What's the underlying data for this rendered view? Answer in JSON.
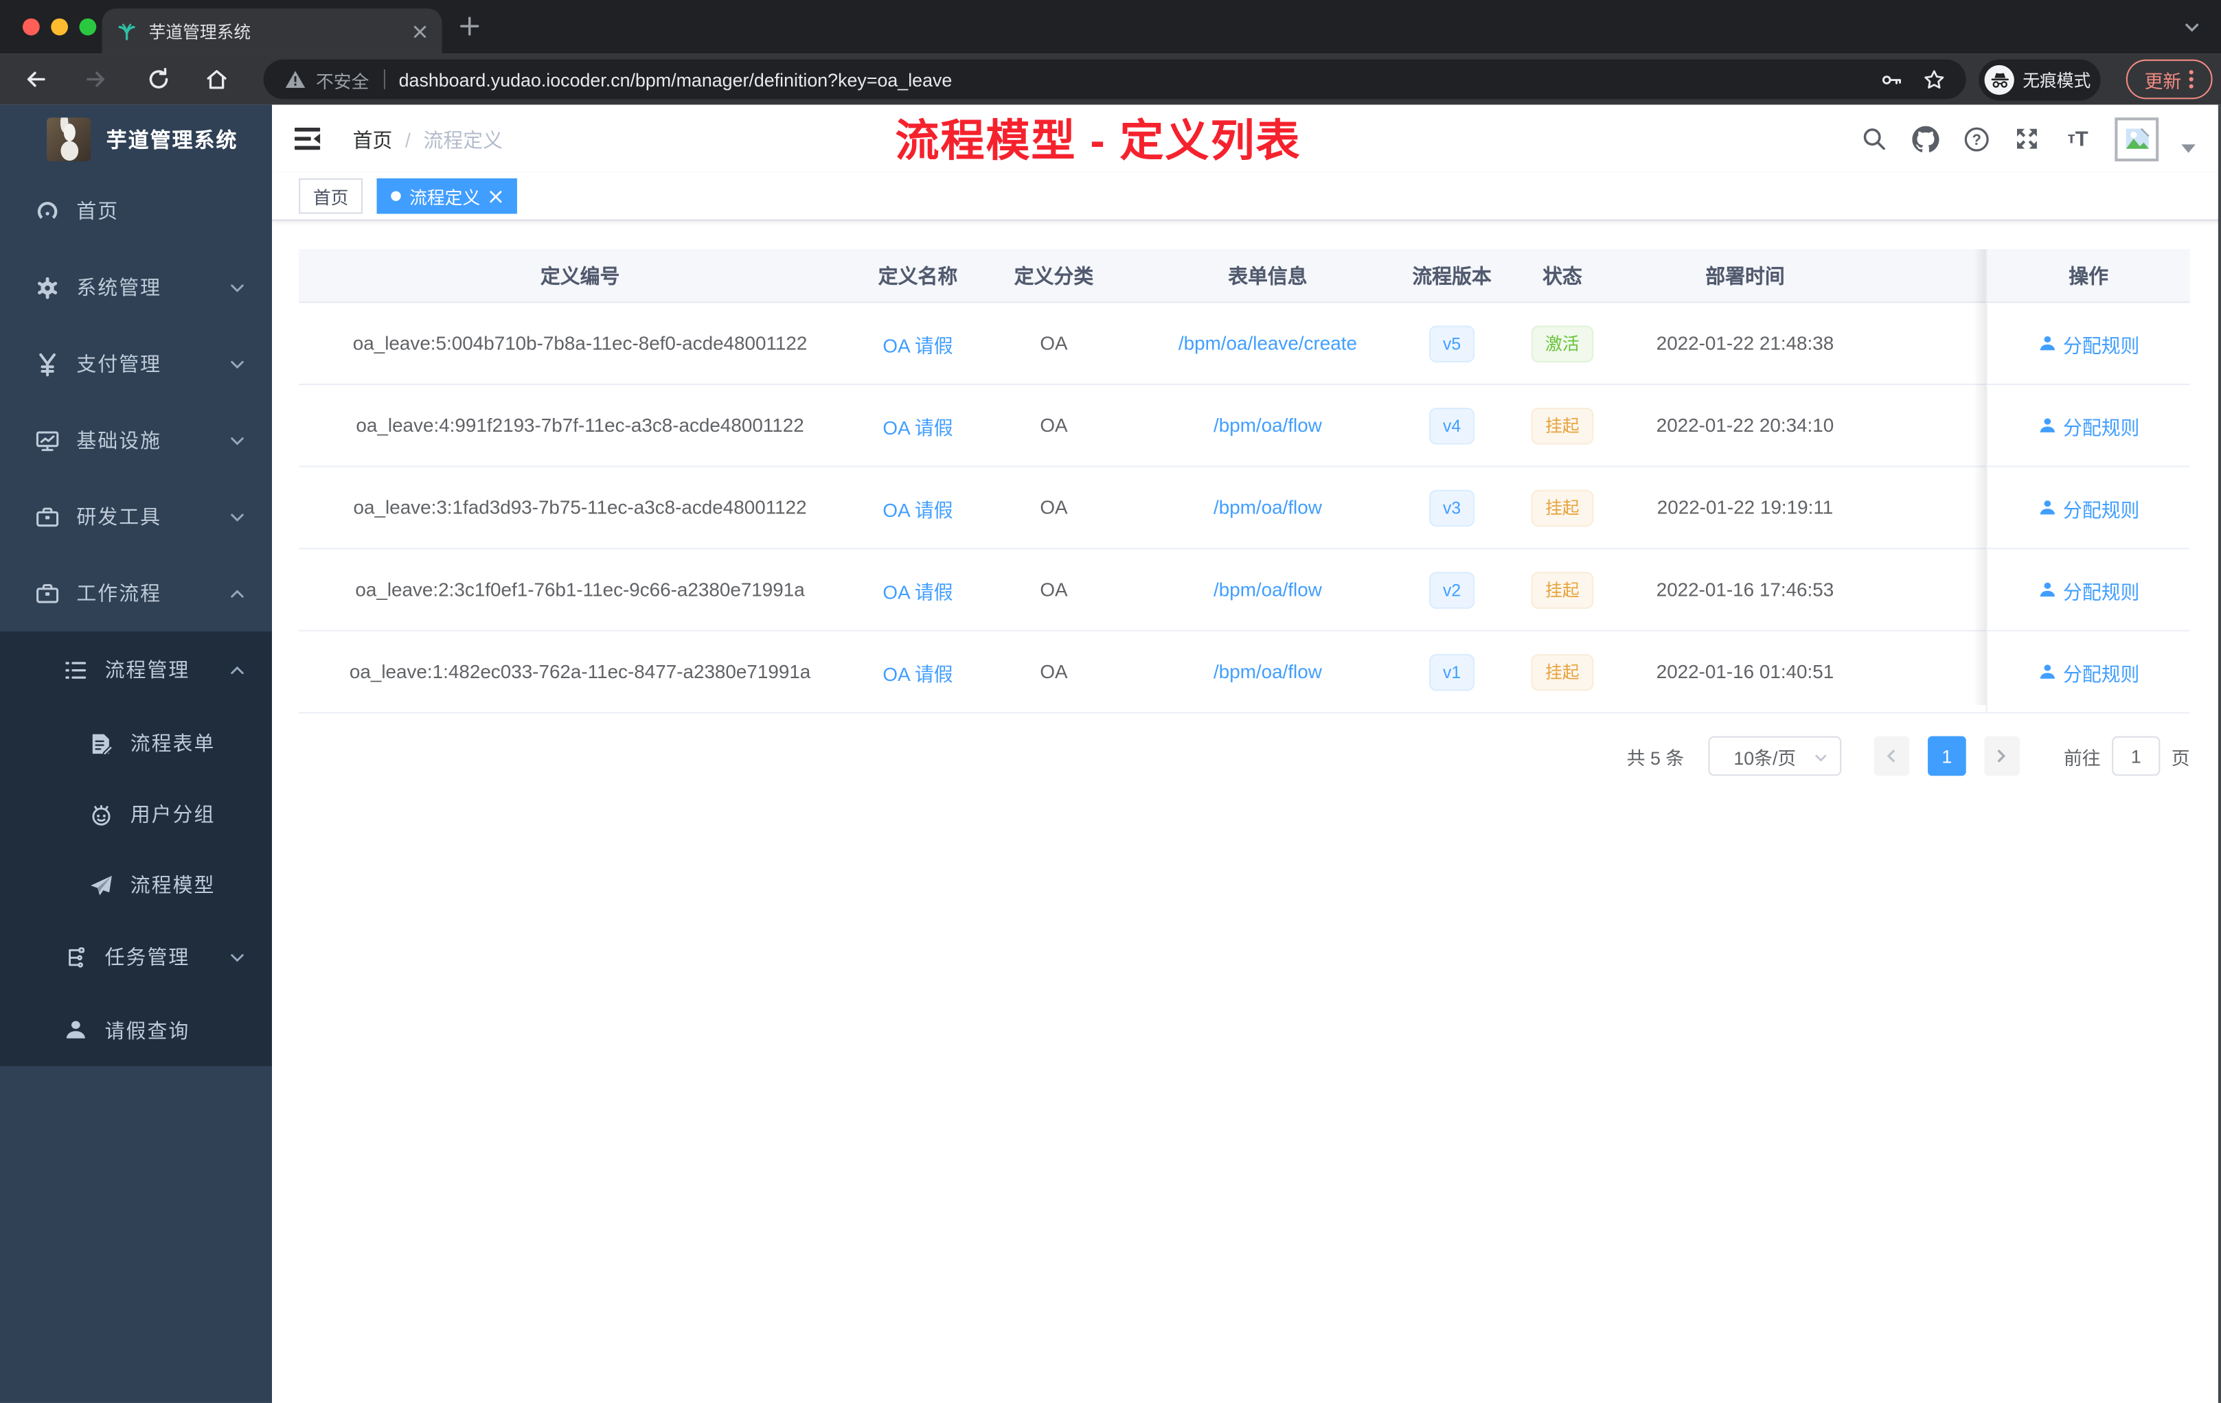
{
  "browser": {
    "tab_title": "芋道管理系统",
    "url_security": "不安全",
    "url": "dashboard.yudao.iocoder.cn/bpm/manager/definition?key=oa_leave",
    "incognito_label": "无痕模式",
    "update_label": "更新"
  },
  "sidebar": {
    "app_title": "芋道管理系统",
    "menu": [
      {
        "label": "首页",
        "icon": "dashboard-icon",
        "chevron": null,
        "level": 1
      },
      {
        "label": "系统管理",
        "icon": "gear-icon",
        "chevron": "down",
        "level": 1
      },
      {
        "label": "支付管理",
        "icon": "yen-icon",
        "chevron": "down",
        "level": 1
      },
      {
        "label": "基础设施",
        "icon": "monitor-icon",
        "chevron": "down",
        "level": 1
      },
      {
        "label": "研发工具",
        "icon": "toolbox-icon",
        "chevron": "down",
        "level": 1
      },
      {
        "label": "工作流程",
        "icon": "briefcase-icon",
        "chevron": "up",
        "level": 1
      }
    ],
    "submenu": [
      {
        "label": "流程管理",
        "icon": "list-tree-icon",
        "chevron": "up",
        "level": 2
      },
      {
        "label": "流程表单",
        "icon": "form-icon",
        "chevron": null,
        "level": 3
      },
      {
        "label": "用户分组",
        "icon": "robot-icon",
        "chevron": null,
        "level": 3
      },
      {
        "label": "流程模型",
        "icon": "paper-plane-icon",
        "chevron": null,
        "level": 3
      },
      {
        "label": "任务管理",
        "icon": "org-tree-icon",
        "chevron": "down",
        "level": 2
      },
      {
        "label": "请假查询",
        "icon": "user-icon",
        "chevron": null,
        "level": 2
      }
    ]
  },
  "navbar": {
    "breadcrumb": [
      "首页",
      "流程定义"
    ],
    "breadcrumb_separator": "/",
    "annotation": "流程模型 - 定义列表"
  },
  "tags": [
    {
      "label": "首页",
      "active": false
    },
    {
      "label": "流程定义",
      "active": true
    }
  ],
  "table": {
    "columns": [
      "定义编号",
      "定义名称",
      "定义分类",
      "表单信息",
      "流程版本",
      "状态",
      "部署时间",
      "操作"
    ],
    "rows": [
      {
        "id": "oa_leave:5:004b710b-7b8a-11ec-8ef0-acde48001122",
        "name": "OA 请假",
        "category": "OA",
        "form": "/bpm/oa/leave/create",
        "version": "v5",
        "status": "激活",
        "status_type": "success",
        "time": "2022-01-22 21:48:38",
        "action": "分配规则"
      },
      {
        "id": "oa_leave:4:991f2193-7b7f-11ec-a3c8-acde48001122",
        "name": "OA 请假",
        "category": "OA",
        "form": "/bpm/oa/flow",
        "version": "v4",
        "status": "挂起",
        "status_type": "warning",
        "time": "2022-01-22 20:34:10",
        "action": "分配规则"
      },
      {
        "id": "oa_leave:3:1fad3d93-7b75-11ec-a3c8-acde48001122",
        "name": "OA 请假",
        "category": "OA",
        "form": "/bpm/oa/flow",
        "version": "v3",
        "status": "挂起",
        "status_type": "warning",
        "time": "2022-01-22 19:19:11",
        "action": "分配规则"
      },
      {
        "id": "oa_leave:2:3c1f0ef1-76b1-11ec-9c66-a2380e71991a",
        "name": "OA 请假",
        "category": "OA",
        "form": "/bpm/oa/flow",
        "version": "v2",
        "status": "挂起",
        "status_type": "warning",
        "time": "2022-01-16 17:46:53",
        "action": "分配规则"
      },
      {
        "id": "oa_leave:1:482ec033-762a-11ec-8477-a2380e71991a",
        "name": "OA 请假",
        "category": "OA",
        "form": "/bpm/oa/flow",
        "version": "v1",
        "status": "挂起",
        "status_type": "warning",
        "time": "2022-01-16 01:40:51",
        "action": "分配规则"
      }
    ]
  },
  "pagination": {
    "total": "共 5 条",
    "page_size": "10条/页",
    "current_page": "1",
    "goto_label": "前往",
    "goto_value": "1",
    "unit_label": "页"
  },
  "colors": {
    "accent": "#409eff",
    "success": "#67c23a",
    "warning": "#e6a23c",
    "annotation_red": "#f5222d",
    "sidebar_bg": "#304156",
    "submenu_bg": "#1f2d3d",
    "chrome_dark": "#202124",
    "chrome_toolbar": "#35363a"
  }
}
